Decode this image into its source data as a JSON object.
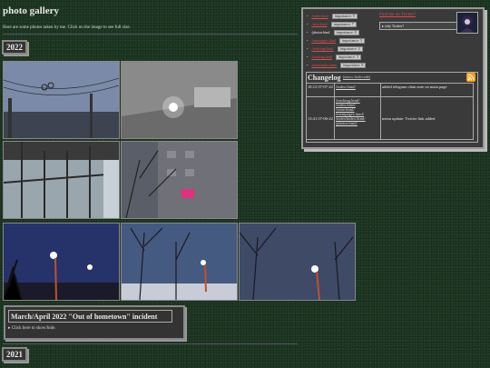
{
  "header": {
    "title": "photo gallery",
    "subtitle": "Here are some photos taken by me. Click on the image to see full size."
  },
  "years": [
    "2022",
    "2021"
  ],
  "photos": [
    {
      "name": "wires-sky"
    },
    {
      "name": "ceiling-light"
    },
    {
      "name": "glass-roof"
    },
    {
      "name": "building-night"
    },
    {
      "name": "street-lamp-1"
    },
    {
      "name": "street-lamp-2"
    },
    {
      "name": "street-lamp-3"
    }
  ],
  "sidebar": {
    "nav": [
      {
        "label": "/index.html",
        "badge": "importance: 9",
        "current": false
      },
      {
        "label": "/wtoe.html",
        "badge": "importance: 7",
        "current": false
      },
      {
        "label": "/photos.html",
        "badge": "importance: 8",
        "current": true
      },
      {
        "label": "/mempages.html",
        "badge": "importance: 5",
        "current": false
      },
      {
        "label": "/webrings.html",
        "badge": "importance: 4",
        "current": false
      },
      {
        "label": "/tracking.html",
        "badge": "importance: 3",
        "current": false
      },
      {
        "label": "/notes/index.html",
        "badge": "importance: 8",
        "current": false
      }
    ],
    "twitter_link": "Find me on Twitter!",
    "why_twitter": "why Twitter?"
  },
  "changelog": {
    "title": "Changelog",
    "links": "(micro, both-code)",
    "rows": [
      {
        "time": "18:12 07-07-22",
        "files": [
          "/index.html/"
        ],
        "text": "added telegram chan note on main page"
      },
      {
        "time": "13:41 07-06-22",
        "files": [
          "/tracking.html/",
          "/index.html/",
          "/wtoe.html/",
          "/mempages.html/",
          "/notes/index.html/",
          "/photos.html/"
        ],
        "text": "menu update: Twitter link added"
      }
    ]
  },
  "incident": {
    "title": "March/April 2022 \"Out of hometown\" incident",
    "toggle": "Click here to show/hide."
  },
  "colors": {
    "background": "#1f3a24",
    "link": "#d05050",
    "panel": "#3a3a3a"
  },
  "icons": {
    "rss": "rss-icon",
    "avatar": "avatar"
  }
}
